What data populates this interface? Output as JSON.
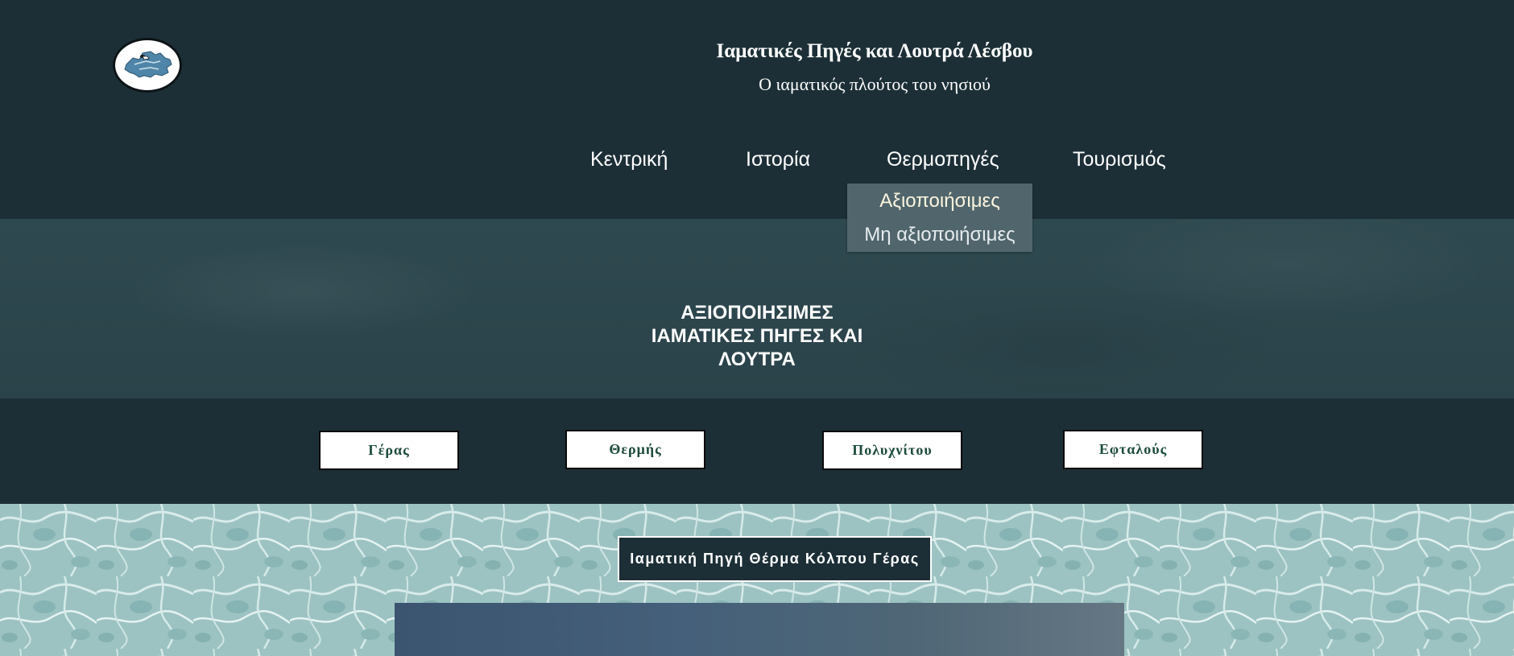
{
  "header": {
    "site_title": "Ιαματικές Πηγές και Λουτρά Λέσβου",
    "site_subtitle": "Ο ιαματικός πλούτος του νησιού",
    "logo_icon": "lesvos-island-logo"
  },
  "nav": {
    "items": [
      {
        "label": "Κεντρική"
      },
      {
        "label": "Ιστορία"
      },
      {
        "label": "Θερμοπηγές"
      },
      {
        "label": "Τουρισμός"
      }
    ],
    "dropdown": {
      "items": [
        {
          "label": "Αξιοποιήσιμες",
          "active": true
        },
        {
          "label": "Μη αξιοποιήσιμες",
          "active": false
        }
      ]
    }
  },
  "hero": {
    "title_line1": "ΑΞΙΟΠΟΙΗΣΙΜΕΣ",
    "title_line2": "ΙΑΜΑΤΙΚΕΣ ΠΗΓΕΣ ΚΑΙ",
    "title_line3": "ΛΟΥΤΡΑ"
  },
  "locations": {
    "buttons": [
      {
        "label": "Γέρας"
      },
      {
        "label": "Θερμής"
      },
      {
        "label": "Πολυχνίτου"
      },
      {
        "label": "Εφταλούς"
      }
    ]
  },
  "section": {
    "caption": "Ιαματική Πηγή Θέρμα Κόλπου Γέρας"
  },
  "colors": {
    "header_bg": "#1c2f36",
    "hero_bg": "#2f4950",
    "dropdown_bg": "#50666c",
    "button_text": "#1d4b3b",
    "water": "#9dc4c3"
  }
}
